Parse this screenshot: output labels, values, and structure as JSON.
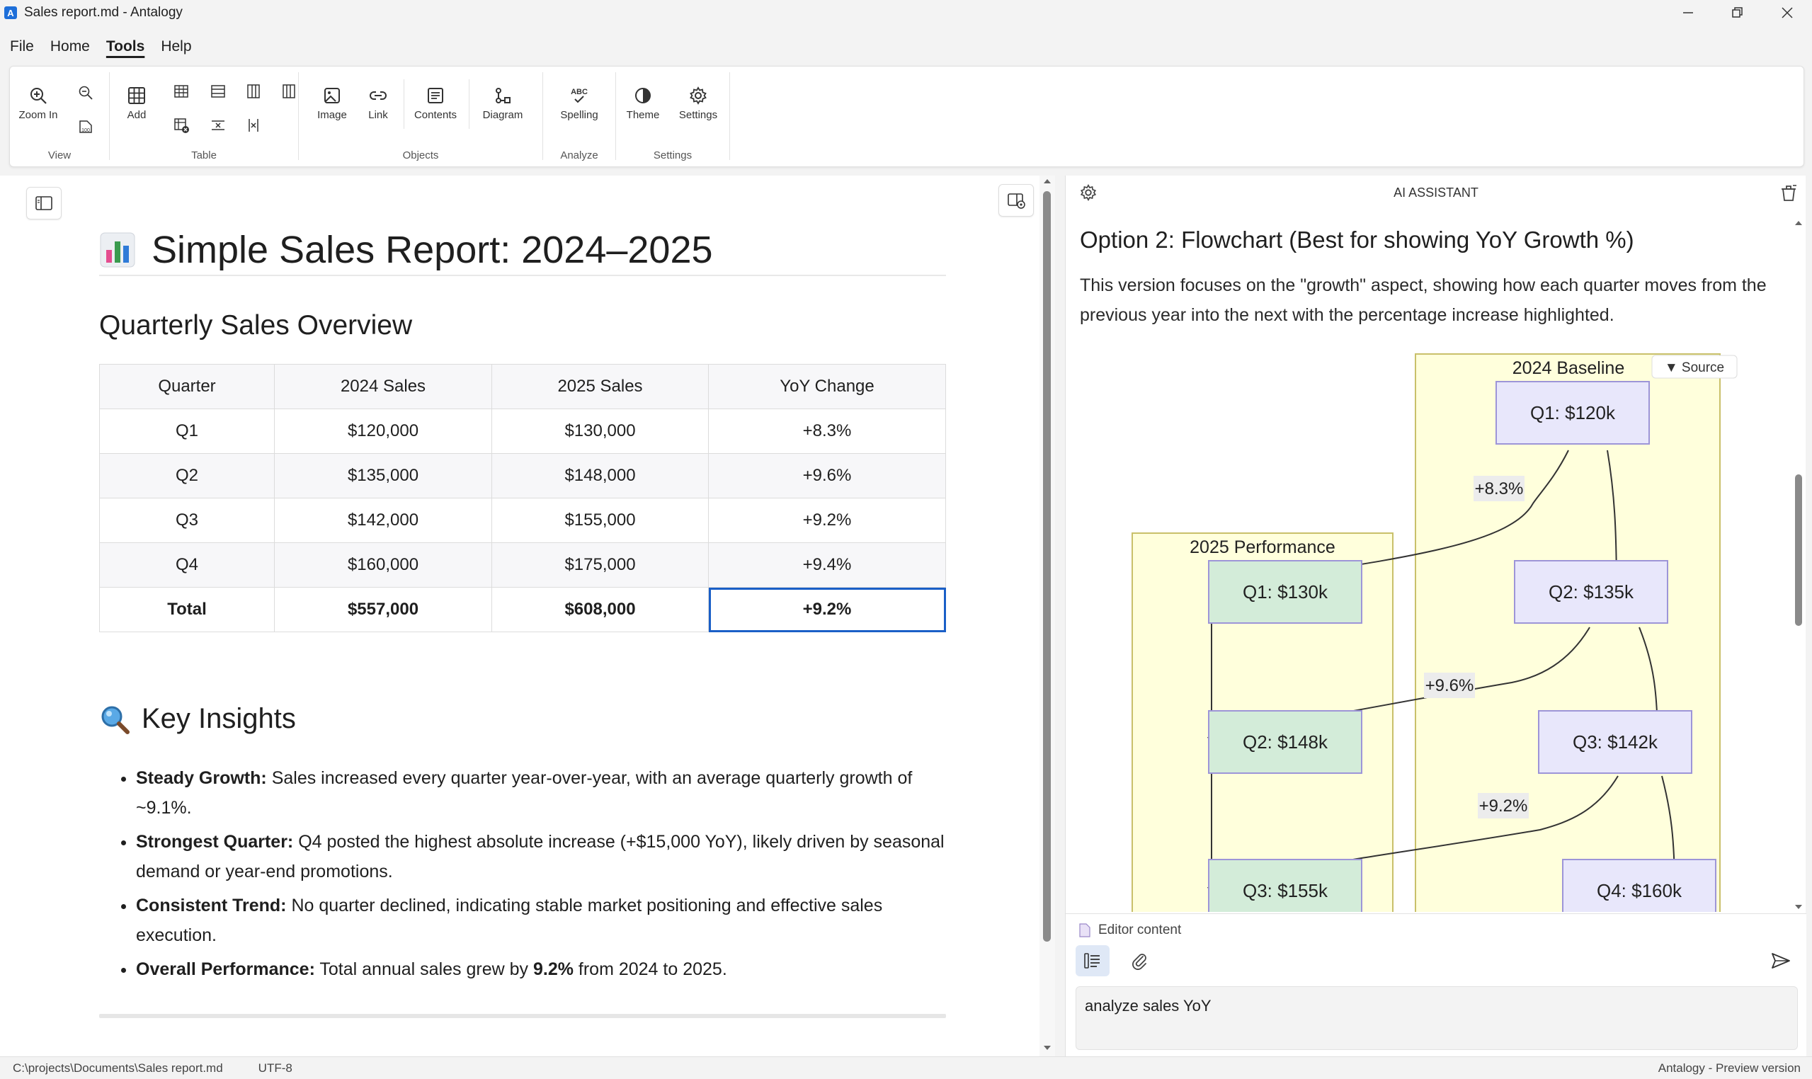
{
  "window": {
    "title": "Sales report.md - Antalogy",
    "app_icon_letter": "A"
  },
  "menu": [
    "File",
    "Home",
    "Tools",
    "Help"
  ],
  "ribbon": {
    "view": {
      "label": "View",
      "zoom_in": "Zoom In"
    },
    "table": {
      "label": "Table",
      "add": "Add"
    },
    "objects": {
      "label": "Objects",
      "image": "Image",
      "link": "Link",
      "contents": "Contents",
      "diagram": "Diagram"
    },
    "analyze": {
      "label": "Analyze",
      "spelling": "Spelling",
      "spelling_badge": "ABC"
    },
    "settings": {
      "label": "Settings",
      "theme": "Theme",
      "settings": "Settings"
    }
  },
  "document": {
    "title": "Simple Sales Report: 2024–2025",
    "section_title": "Quarterly Sales Overview",
    "table": {
      "headers": [
        "Quarter",
        "2024 Sales",
        "2025 Sales",
        "YoY Change"
      ],
      "rows": [
        [
          "Q1",
          "$120,000",
          "$130,000",
          "+8.3%"
        ],
        [
          "Q2",
          "$135,000",
          "$148,000",
          "+9.6%"
        ],
        [
          "Q3",
          "$142,000",
          "$155,000",
          "+9.2%"
        ],
        [
          "Q4",
          "$160,000",
          "$175,000",
          "+9.4%"
        ],
        [
          "Total",
          "$557,000",
          "$608,000",
          "+9.2%"
        ]
      ]
    },
    "insights_title": "Key Insights",
    "insights": [
      {
        "bold": "Steady Growth:",
        "text": " Sales increased every quarter year-over-year, with an average quarterly growth of ~9.1%."
      },
      {
        "bold": "Strongest Quarter:",
        "text": " Q4 posted the highest absolute increase (+$15,000 YoY), likely driven by seasonal demand or year-end promotions."
      },
      {
        "bold": "Consistent Trend:",
        "text": " No quarter declined, indicating stable market positioning and effective sales execution."
      },
      {
        "bold": "Overall Performance:",
        "text": " Total annual sales grew by ",
        "bold2": "9.2%",
        "text2": " from 2024 to 2025."
      }
    ]
  },
  "ai": {
    "header": "AI ASSISTANT",
    "heading": "Option 2: Flowchart (Best for showing YoY Growth %)",
    "paragraph": "This version focuses on the \"growth\" aspect, showing how each quarter moves from the previous year into the next with the percentage increase highlighted.",
    "source_button": "▼ Source",
    "flow": {
      "cluster_2024": "2024 Baseline",
      "cluster_2025": "2025 Performance",
      "nodes_2024": [
        "Q1: $120k",
        "Q2: $135k",
        "Q3: $142k",
        "Q4: $160k"
      ],
      "nodes_2025": [
        "Q1: $130k",
        "Q2: $148k",
        "Q3: $155k"
      ],
      "edge_labels": [
        "+8.3%",
        "+9.6%",
        "+9.2%"
      ]
    },
    "context_label": "Editor content",
    "input_value": "analyze sales YoY"
  },
  "status": {
    "path": "C:\\projects\\Documents\\Sales report.md",
    "encoding": "UTF-8",
    "right": "Antalogy - Preview version"
  },
  "colors": {
    "accent": "#1a5fc7",
    "node_2024": "#e8e7fb",
    "node_2025": "#d3ecd9",
    "cluster": "#ffffdc"
  }
}
